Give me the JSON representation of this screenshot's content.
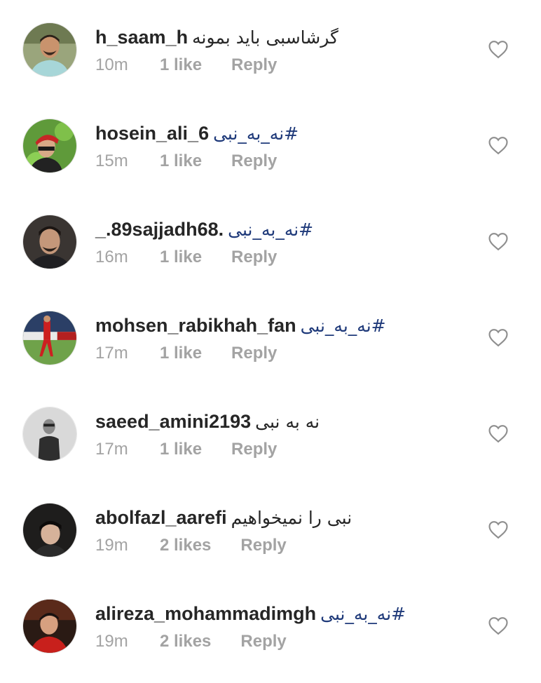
{
  "comments": [
    {
      "username": "h_saam_h",
      "text": "گرشاسبی باید بمونه",
      "hashtag": "",
      "time": "10m",
      "likes": "1 like",
      "reply": "Reply",
      "avatar": "man-smiling-avatar"
    },
    {
      "username": "hosein_ali_6",
      "text": "",
      "hashtag": "#نه_به_نبی",
      "time": "15m",
      "likes": "1 like",
      "reply": "Reply",
      "avatar": "man-red-cap-avatar"
    },
    {
      "username": "_.89sajjadh68.",
      "text": "",
      "hashtag": "#نه_به_نبی",
      "time": "16m",
      "likes": "1 like",
      "reply": "Reply",
      "avatar": "man-portrait-avatar"
    },
    {
      "username": "mohsen_rabikhah_fan",
      "text": "",
      "hashtag": "#نه_به_نبی",
      "time": "17m",
      "likes": "1 like",
      "reply": "Reply",
      "avatar": "football-player-avatar"
    },
    {
      "username": "saeed_amini2193",
      "text": "نه به نبی",
      "hashtag": "",
      "time": "17m",
      "likes": "1 like",
      "reply": "Reply",
      "avatar": "man-grayscale-avatar"
    },
    {
      "username": "abolfazl_aarefi",
      "text": "نبی را نمیخواهیم",
      "hashtag": "",
      "time": "19m",
      "likes": "2 likes",
      "reply": "Reply",
      "avatar": "man-dark-avatar"
    },
    {
      "username": "alireza_mohammadimgh",
      "text": "",
      "hashtag": "#نه_به_نبی",
      "time": "19m",
      "likes": "2 likes",
      "reply": "Reply",
      "avatar": "man-red-shirt-avatar"
    }
  ],
  "colors": {
    "text": "#262626",
    "meta": "#a3a3a3",
    "hashtag": "#1f3a7a",
    "heart_outline": "#8e8e8e"
  }
}
